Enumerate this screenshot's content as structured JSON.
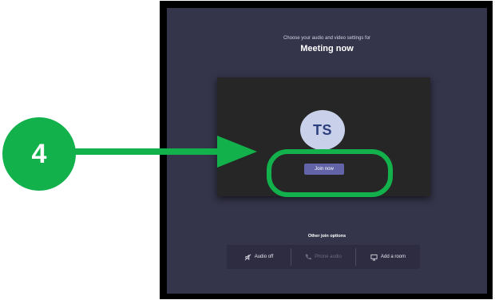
{
  "header": {
    "subtitle": "Choose your audio and video settings for",
    "title": "Meeting now"
  },
  "preview": {
    "avatar_initials": "TS",
    "join_label": "Join now"
  },
  "annotation": {
    "step_number": "4",
    "accent_color": "#12b14b"
  },
  "other_options": {
    "heading": "Other join options",
    "items": [
      {
        "label": "Audio off",
        "icon": "audio-off-icon",
        "enabled": true
      },
      {
        "label": "Phone audio",
        "icon": "phone-icon",
        "enabled": false
      },
      {
        "label": "Add a room",
        "icon": "room-icon",
        "enabled": true
      }
    ]
  },
  "colors": {
    "window_bg": "#34344a",
    "card_bg": "#262626",
    "join_button": "#6264a7",
    "avatar_bg": "#c9d1ea"
  }
}
